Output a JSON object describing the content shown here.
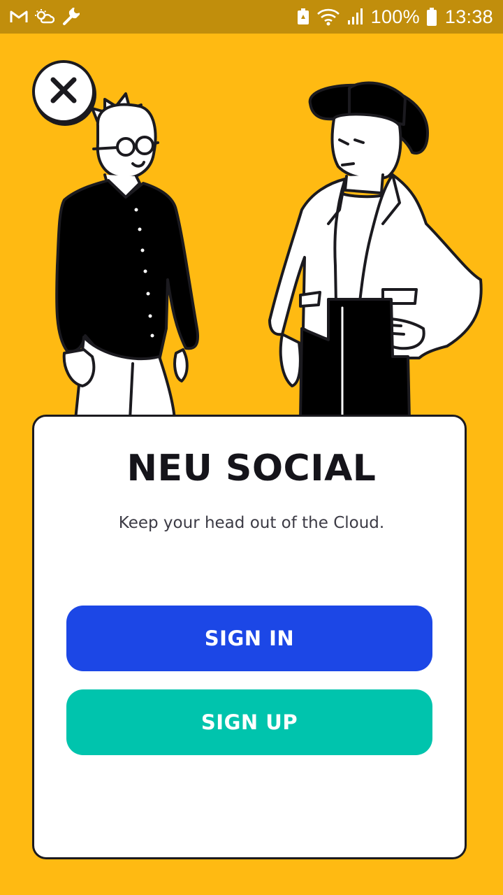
{
  "status_bar": {
    "battery": "100%",
    "time": "13:38",
    "icons": [
      "gmail-icon",
      "weather-icon",
      "wrench-icon",
      "battery-saver-icon",
      "wifi-icon",
      "signal-icon",
      "battery-icon"
    ]
  },
  "close_button": {
    "icon": "close-icon"
  },
  "card": {
    "title": "NEU SOCIAL",
    "tagline": "Keep your head out of the Cloud.",
    "sign_in_label": "SIGN IN",
    "sign_up_label": "SIGN UP"
  },
  "colors": {
    "background": "#FFBA12",
    "status_bar": "#C18E0C",
    "sign_in": "#1C47E6",
    "sign_up": "#00C4AD",
    "ink": "#1B1A1F"
  }
}
